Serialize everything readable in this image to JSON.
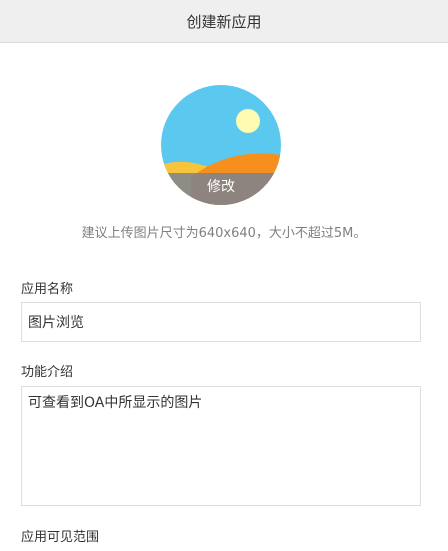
{
  "header": {
    "title": "创建新应用"
  },
  "icon": {
    "edit_label": "修改",
    "icon_name": "gallery-image-icon",
    "colors": {
      "sky": "#5bc8f0",
      "sun": "#fffbb0",
      "hill_orange": "#f5901e",
      "hill_yellow": "#f8c43c",
      "overlay": "#7b8391"
    }
  },
  "hint": {
    "text": "建议上传图片尺寸为640x640，大小不超过5M。"
  },
  "form": {
    "name_label": "应用名称",
    "name_value": "图片浏览",
    "desc_label": "功能介绍",
    "desc_value": "可查看到OA中所显示的图片",
    "visibility_label": "应用可见范围"
  }
}
